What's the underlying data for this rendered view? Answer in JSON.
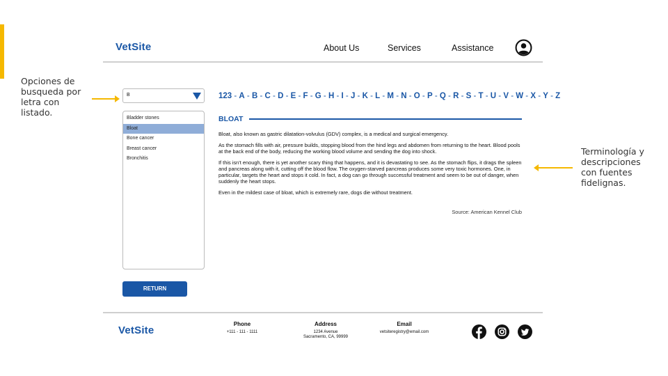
{
  "annotations": {
    "left_note": "Opciones de busqueda por letra con listado.",
    "right_note": "Terminología y descripciones con fuentes fidelignas."
  },
  "header": {
    "logo": "VetSite",
    "nav": [
      "About Us",
      "Services",
      "Assistance"
    ],
    "user_icon": "user-circle-icon"
  },
  "search": {
    "selected_letter": "B",
    "list": [
      "Bladder stones",
      "Bloat",
      "Bone cancer",
      "Breast cancer",
      "Bronchitis"
    ],
    "selected_item": "Bloat",
    "return_label": "RETURN"
  },
  "alphabet": [
    "123",
    "A",
    "B",
    "C",
    "D",
    "E",
    "F",
    "G",
    "H",
    "I",
    "J",
    "K",
    "L",
    "M",
    "N",
    "O",
    "P",
    "Q",
    "R",
    "S",
    "T",
    "U",
    "V",
    "W",
    "X",
    "Y",
    "Z"
  ],
  "article": {
    "title": "BLOAT",
    "paragraphs": [
      "Bloat, also known as gastric dilatation-volvulus (GDV) complex, is a medical and surgical emergency.",
      "As the stomach fills with air, pressure builds, stopping blood from the hind legs and abdomen from returning to the heart. Blood pools at the back end of the body, reducing the working blood volume and sending the dog into shock.",
      "If this isn’t enough, there is yet another scary thing that happens, and it is devastating to see. As the stomach flips, it drags the spleen and pancreas along with it, cutting off the blood flow. The oxygen-starved pancreas produces some very toxic hormones. One, in particular, targets the heart and stops it cold. In fact, a dog can go through successful treatment and seem to be out of danger, when suddenly the heart stops.",
      "Even in the mildest case of bloat, which is extremely rare, dogs die without treatment."
    ],
    "source": "Source: American Kennel Club"
  },
  "footer": {
    "logo": "VetSite",
    "phone_label": "Phone",
    "phone_value": "+111 - 111 - 1111",
    "address_label": "Address",
    "address_line1": "1234 Avenue",
    "address_line2": "Sacramento, CA, 99999",
    "email_label": "Email",
    "email_value": "vetsiteregistry@email.com",
    "social_icons": [
      "facebook-icon",
      "instagram-icon",
      "twitter-icon"
    ]
  },
  "colors": {
    "brand_blue": "#1a57a6",
    "accent_yellow": "#f5b800",
    "selected_row": "#8fadd8"
  }
}
